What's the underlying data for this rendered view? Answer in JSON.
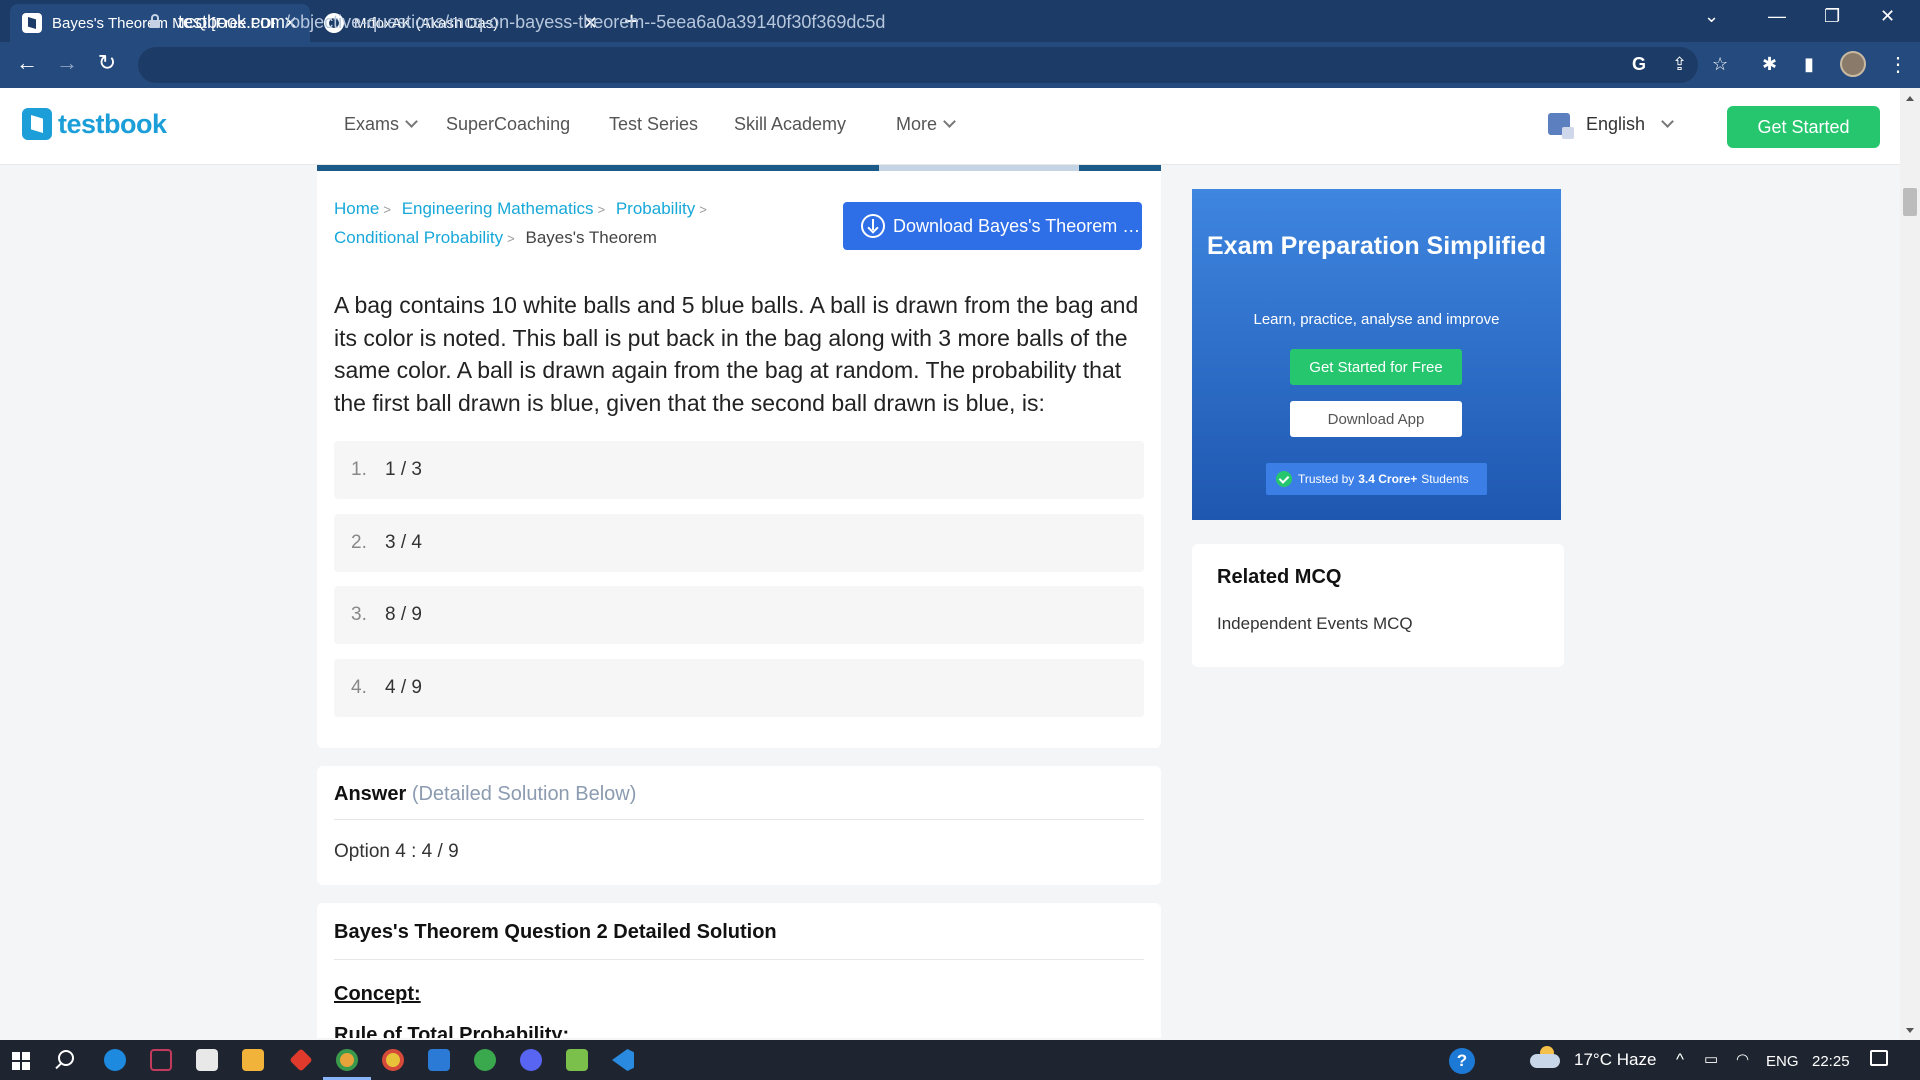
{
  "browser": {
    "tabs": [
      {
        "title": "Bayes's Theorem MCQ [Free PDF",
        "close": "✕"
      },
      {
        "title": "MrfoxAK (Akash Das)",
        "close": "✕"
      }
    ],
    "new_tab": "+",
    "url_domain": "testbook.com",
    "url_path": "/objective-questions/mcq-on-bayess-theorem--5eea6a0a39140f30f369dc5d",
    "nav": {
      "back": "←",
      "forward": "→",
      "reload": "↻"
    },
    "window": {
      "minimize": "—",
      "restore": "❐",
      "close": "✕",
      "tabs_menu": "⌄"
    },
    "extensions": {
      "google": "G",
      "share": "⇪",
      "star": "☆",
      "puzzle": "✱",
      "sidepanel": "▮",
      "menu": "⋮"
    }
  },
  "header": {
    "logo": "testbook",
    "nav": [
      {
        "label": "Exams",
        "dropdown": true
      },
      {
        "label": "SuperCoaching",
        "dropdown": false
      },
      {
        "label": "Test Series",
        "dropdown": false
      },
      {
        "label": "Skill Academy",
        "dropdown": false
      },
      {
        "label": "More",
        "dropdown": true
      }
    ],
    "language": "English",
    "cta": "Get Started"
  },
  "breadcrumb": {
    "items": [
      "Home",
      "Engineering Mathematics",
      "Probability",
      "Conditional Probability"
    ],
    "current": "Bayes's Theorem"
  },
  "download_button": "Download Bayes's Theorem MCQ PDF",
  "question": "A bag contains 10 white balls and 5 blue balls. A ball is drawn from the bag and its color is noted. This ball is put back in the bag along with 3 more balls of the same color. A ball is drawn again from the bag at random. The probability that the first ball drawn is blue, given that the second ball drawn is blue, is:",
  "options": [
    {
      "num": "1.",
      "text": "1 / 3"
    },
    {
      "num": "2.",
      "text": "3 / 4"
    },
    {
      "num": "3.",
      "text": "8 / 9"
    },
    {
      "num": "4.",
      "text": "4 / 9"
    }
  ],
  "answer": {
    "heading": "Answer",
    "note": "(Detailed Solution Below)",
    "value": "Option 4 : 4 / 9"
  },
  "solution": {
    "title": "Bayes's Theorem Question 2 Detailed Solution",
    "concept": "Concept:",
    "rule": "Rule of Total Probability:"
  },
  "sidebar": {
    "promo": {
      "title": "Exam Preparation Simplified",
      "subtitle": "Learn, practice, analyse and improve",
      "start_button": "Get Started for Free",
      "app_button": "Download App",
      "trust_prefix": "Trusted by",
      "trust_count": "3.4 Crore+",
      "trust_suffix": "Students"
    },
    "related": {
      "title": "Related MCQ",
      "items": [
        "Independent Events MCQ"
      ]
    }
  },
  "taskbar": {
    "help": "?",
    "temperature": "17°C",
    "weather": "Haze",
    "lang": "ENG",
    "time": "22:25",
    "tray_chevron": "^"
  },
  "colors": {
    "chrome_dark": "#1c3b66",
    "chrome": "#254b7e",
    "brand": "#1c9ed8",
    "cta_green": "#26c66f",
    "download_blue": "#2e6ee6",
    "link": "#17a8d9"
  }
}
